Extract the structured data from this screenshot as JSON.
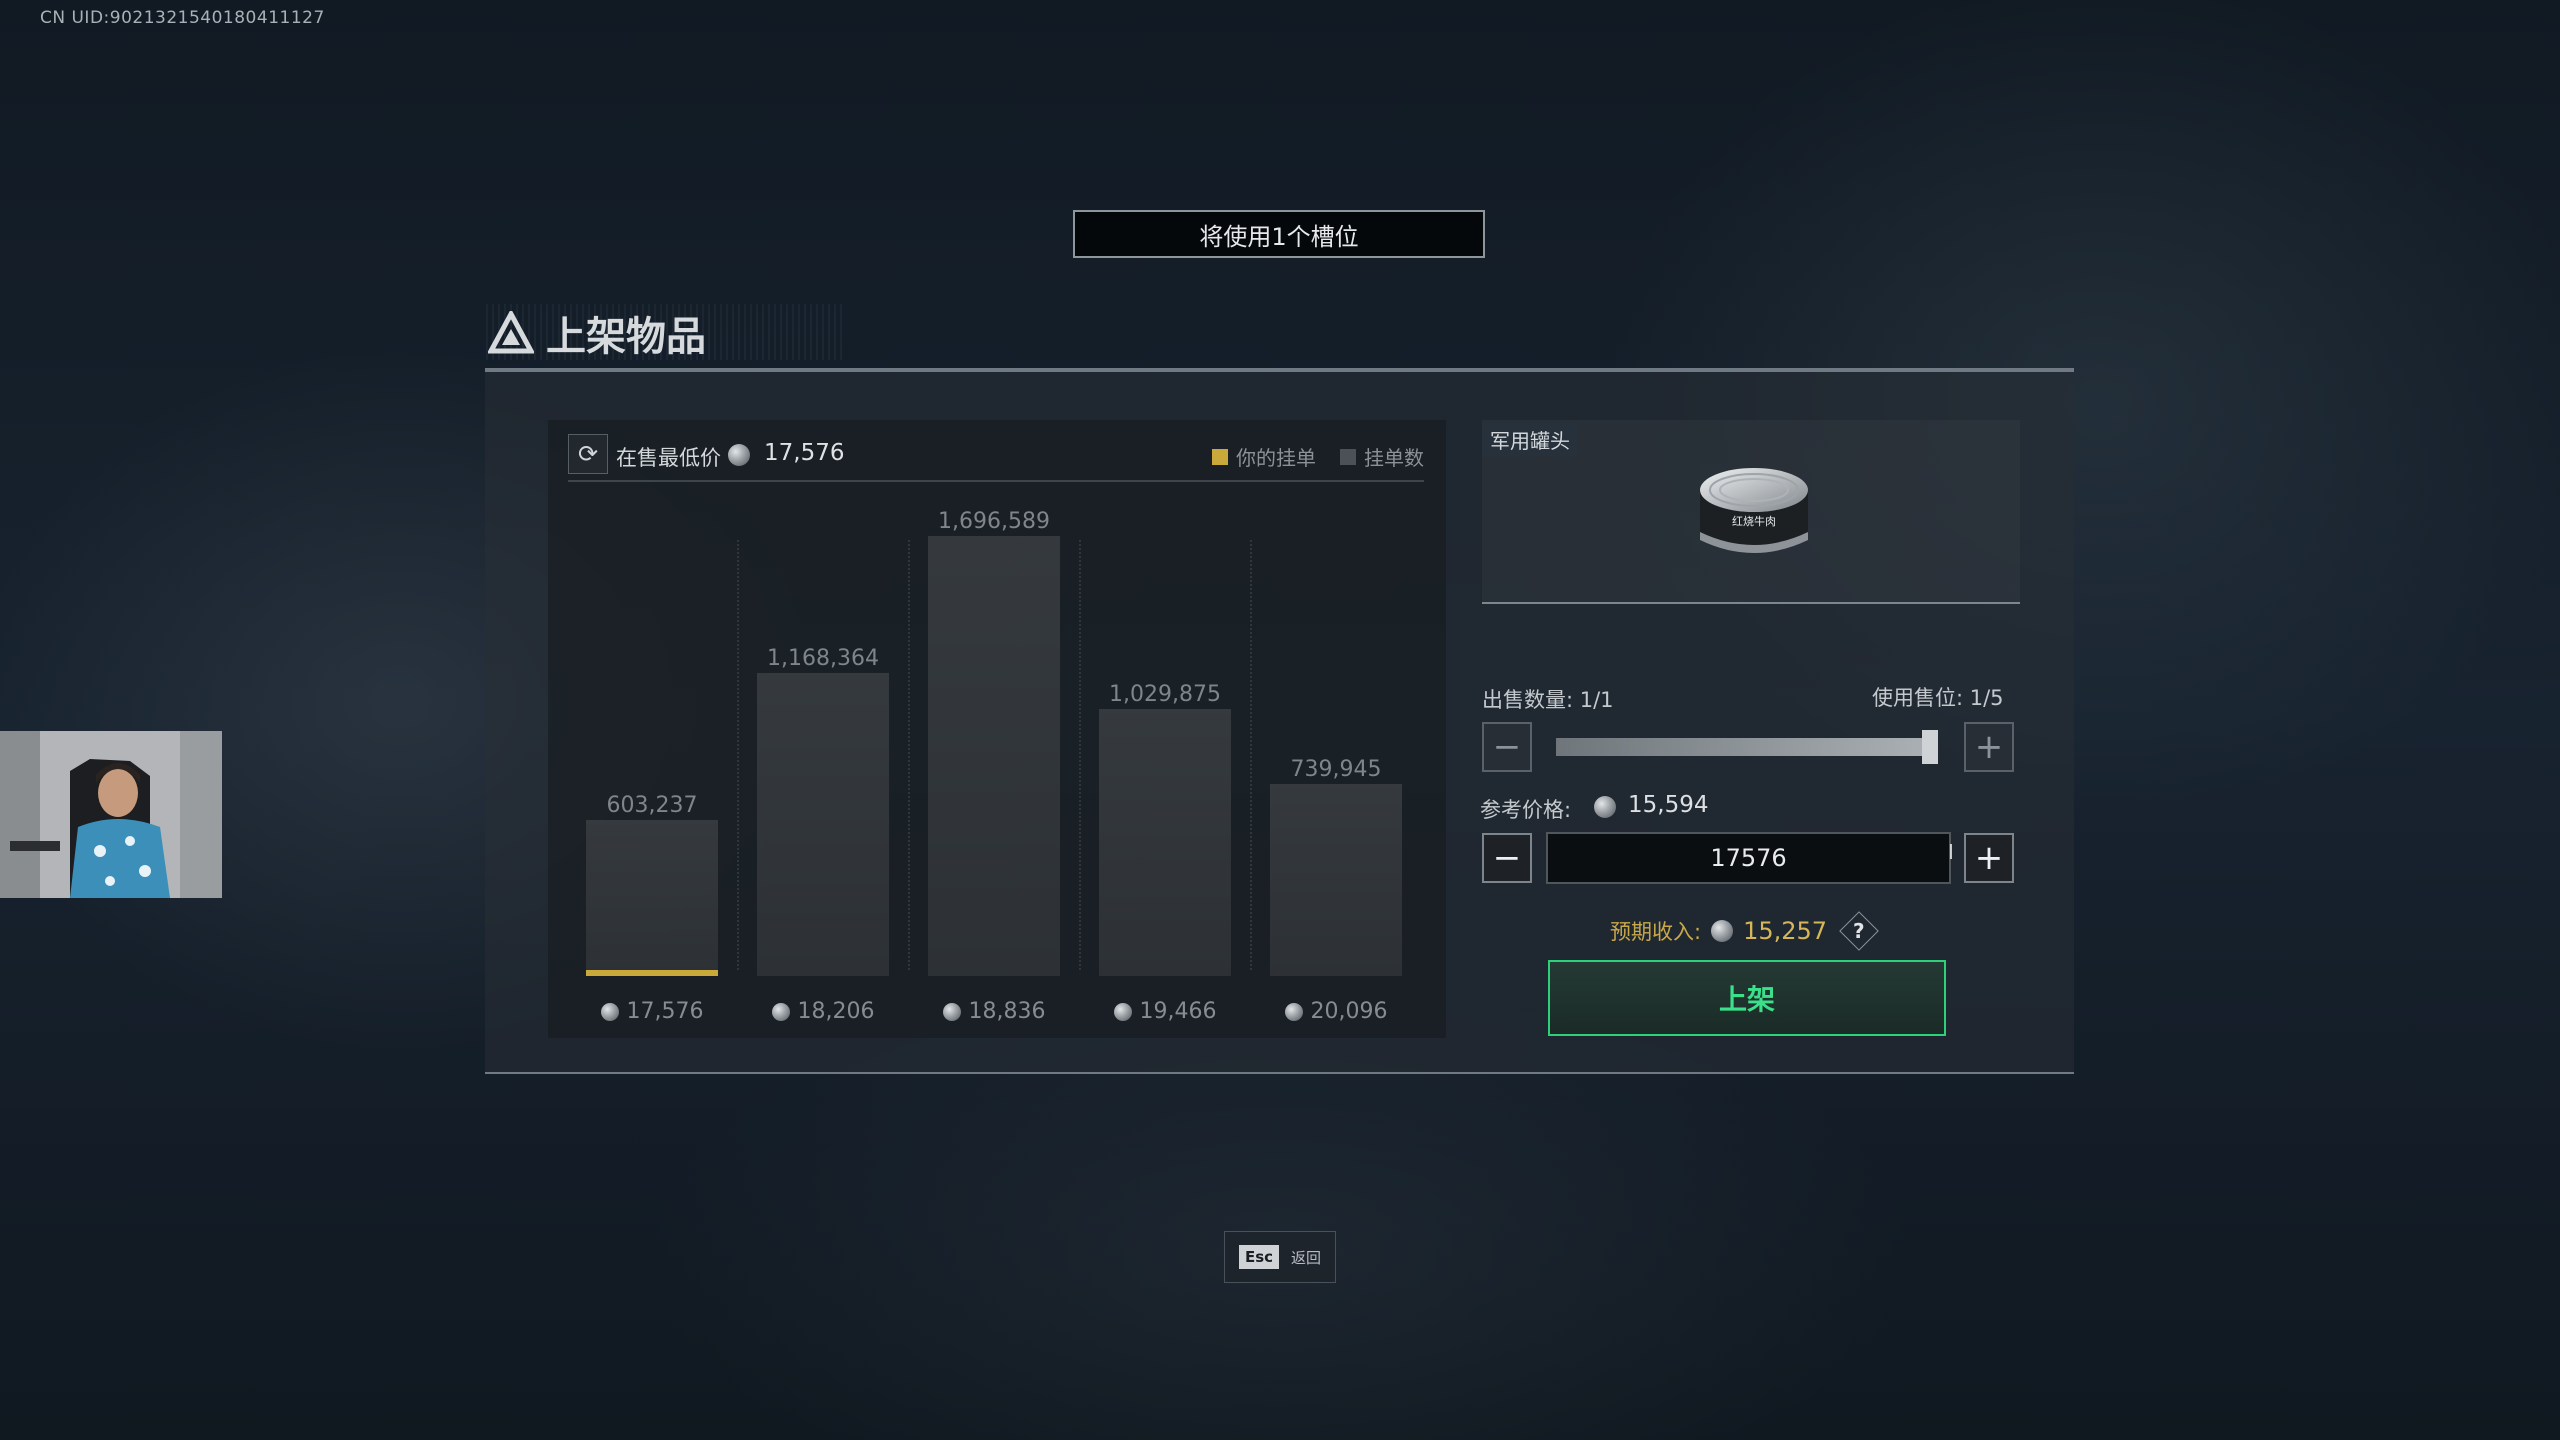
{
  "uid_text": "CN UID:9021321540180411127",
  "slot_banner": "将使用1个槽位",
  "panel_title": "上架物品",
  "chart_header": {
    "lowest_label": "在售最低价",
    "lowest_value": "17,576",
    "legend": [
      {
        "label": "你的挂单",
        "color": "#c8a93a"
      },
      {
        "label": "挂单数",
        "color": "#4b5157"
      }
    ]
  },
  "chart_data": {
    "type": "bar",
    "categories": [
      "17,576",
      "18,206",
      "18,836",
      "19,466",
      "20,096"
    ],
    "values": [
      603237,
      1168364,
      1696589,
      1029875,
      739945
    ],
    "value_labels": [
      "603,237",
      "1,168,364",
      "1,696,589",
      "1,029,875",
      "739,945"
    ],
    "title": "",
    "xlabel": "",
    "ylabel": "",
    "ylim": [
      0,
      1696589
    ],
    "grid": false,
    "legend_placement": "top-right",
    "highlighted_category_index": 0
  },
  "item": {
    "tag": "军用罐头",
    "icon": "canned-beef-icon"
  },
  "quantity": {
    "label": "出售数量: 1/1",
    "slots_label": "使用售位: 1/5",
    "fraction": 1.0,
    "minus": "−",
    "plus": "+"
  },
  "reference_price": {
    "label": "参考价格:",
    "value": "15,594"
  },
  "price_input": {
    "value": "17576",
    "minus": "−",
    "plus": "+"
  },
  "income": {
    "label": "预期收入:",
    "value": "15,257",
    "help": "?"
  },
  "list_button": "上架",
  "esc": {
    "key": "Esc",
    "label": "返回"
  },
  "colors": {
    "accent_green": "#2fd07a",
    "highlight_gold": "#c8a93a"
  }
}
